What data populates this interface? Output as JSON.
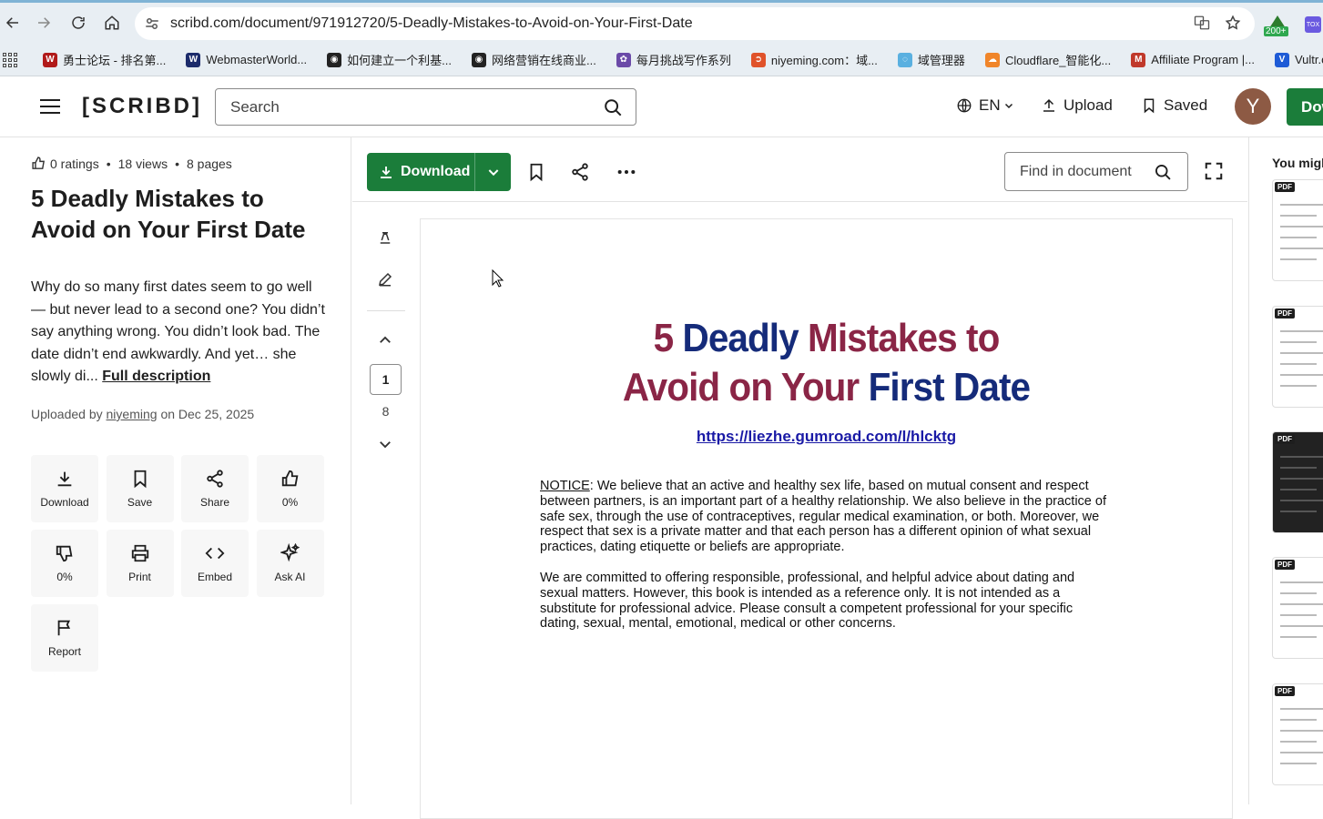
{
  "browser": {
    "url": "scribd.com/document/971912720/5-Deadly-Mistakes-to-Avoid-on-Your-First-Date",
    "extension_badge": "200+",
    "bookmarks": [
      {
        "label": "勇士论坛 - 排名第...",
        "color": "#b11a1a",
        "letter": "W"
      },
      {
        "label": "WebmasterWorld...",
        "color": "#1c2b6b",
        "letter": "W"
      },
      {
        "label": "如何建立一个利基...",
        "color": "#222222",
        "letter": "◉"
      },
      {
        "label": "网络营销在线商业...",
        "color": "#222222",
        "letter": "◉"
      },
      {
        "label": "每月挑战写作系列",
        "color": "#6b4aa8",
        "letter": "✿"
      },
      {
        "label": "niyeming.com：域...",
        "color": "#e0522a",
        "letter": "➲"
      },
      {
        "label": "域管理器",
        "color": "#5ab0e0",
        "letter": "◌"
      },
      {
        "label": "Cloudflare_智能化...",
        "color": "#f0852a",
        "letter": "☁"
      },
      {
        "label": "Affiliate Program |...",
        "color": "#c0392b",
        "letter": "M"
      },
      {
        "label": "Vultr.co",
        "color": "#1e5bd6",
        "letter": "V"
      }
    ]
  },
  "header": {
    "logo": "[SCRIBD]",
    "search_placeholder": "Search",
    "language": "EN",
    "upload_label": "Upload",
    "saved_label": "Saved",
    "avatar_letter": "Y",
    "download_label": "Dow"
  },
  "info": {
    "ratings": "0 ratings",
    "views": "18 views",
    "pages": "8 pages",
    "title": "5 Deadly Mistakes to Avoid on Your First Date",
    "description": "Why do so many first dates seem to go well — but never lead to a second one? You didn’t say anything wrong. You didn’t look bad. The date didn’t end awkwardly. And yet… she slowly di...",
    "full_description_link": "Full description",
    "uploaded_prefix": "Uploaded by",
    "uploader": "niyeming",
    "uploaded_suffix": "on Dec 25, 2025",
    "actions": [
      {
        "label": "Download",
        "icon": "download-icon"
      },
      {
        "label": "Save",
        "icon": "bookmark-icon"
      },
      {
        "label": "Share",
        "icon": "share-icon"
      },
      {
        "label": "0%",
        "icon": "thumbs-up-icon"
      },
      {
        "label": "0%",
        "icon": "thumbs-down-icon"
      },
      {
        "label": "Print",
        "icon": "print-icon"
      },
      {
        "label": "Embed",
        "icon": "code-icon"
      },
      {
        "label": "Ask AI",
        "icon": "sparkle-icon"
      },
      {
        "label": "Report",
        "icon": "flag-icon"
      }
    ]
  },
  "toolbar": {
    "download_label": "Download",
    "find_placeholder": "Find in document"
  },
  "pager": {
    "current": "1",
    "total": "8"
  },
  "document": {
    "title_parts": [
      {
        "text": "5 ",
        "color": "maroon"
      },
      {
        "text": "Deadly ",
        "color": "navy"
      },
      {
        "text": "Mistakes to",
        "color": "maroon"
      }
    ],
    "title_parts_2": [
      {
        "text": "Avoid on Your ",
        "color": "maroon"
      },
      {
        "text": "First Date",
        "color": "navy"
      }
    ],
    "link": "https://liezhe.gumroad.com/l/hlcktg",
    "notice_label": "NOTICE",
    "notice_text": ": We believe that an active and healthy sex life, based on mutual consent and respect between partners, is an important part of a healthy relationship. We also believe in the practice of safe sex, through the use of contraceptives, regular medical examination, or both. Moreover, we respect that sex is a private matter and that each person has a different opinion of what sexual practices, dating etiquette or beliefs are appropriate.",
    "paragraph2": "We are committed to offering responsible, professional, and helpful advice about dating and sexual matters. However, this book is intended as a reference only. It is not intended as a substitute for professional advice. Please consult a competent professional for your specific dating, sexual, mental, emotional, medical or other concerns."
  },
  "right_rail": {
    "title": "You migh",
    "thumb_badge": "PDF"
  },
  "colors": {
    "brand_green": "#1b7d3a",
    "title_navy": "#152b7a",
    "title_maroon": "#8a2546",
    "link_blue": "#1a1aa6"
  }
}
